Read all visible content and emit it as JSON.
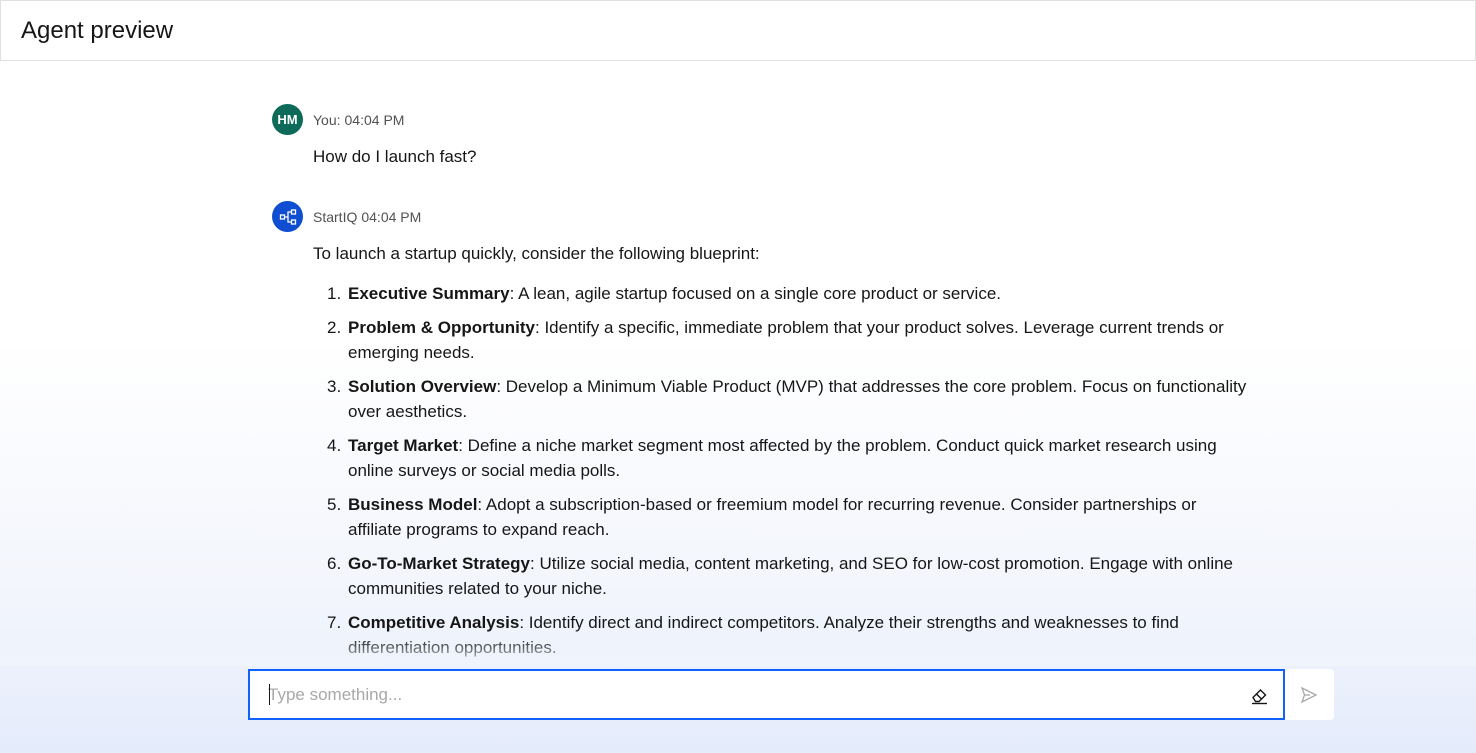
{
  "header": {
    "title": "Agent preview"
  },
  "messages": {
    "user": {
      "initials": "HM",
      "author": "You:",
      "time": "04:04 PM",
      "text": "How do I launch fast?"
    },
    "agent": {
      "author": "StartIQ",
      "time": "04:04 PM",
      "intro": "To launch a startup quickly, consider the following blueprint:",
      "items": [
        {
          "num": "1.",
          "title": "Executive Summary",
          "text": ": A lean, agile startup focused on a single core product or service."
        },
        {
          "num": "2.",
          "title": "Problem & Opportunity",
          "text": ": Identify a specific, immediate problem that your product solves. Leverage current trends or emerging needs."
        },
        {
          "num": "3.",
          "title": "Solution Overview",
          "text": ": Develop a Minimum Viable Product (MVP) that addresses the core problem. Focus on functionality over aesthetics."
        },
        {
          "num": "4.",
          "title": "Target Market",
          "text": ": Define a niche market segment most affected by the problem. Conduct quick market research using online surveys or social media polls."
        },
        {
          "num": "5.",
          "title": "Business Model",
          "text": ": Adopt a subscription-based or freemium model for recurring revenue. Consider partnerships or affiliate programs to expand reach."
        },
        {
          "num": "6.",
          "title": "Go-To-Market Strategy",
          "text": ": Utilize social media, content marketing, and SEO for low-cost promotion. Engage with online communities related to your niche."
        },
        {
          "num": "7.",
          "title": "Competitive Analysis",
          "text": ": Identify direct and indirect competitors. Analyze their strengths and weaknesses to find differentiation opportunities."
        }
      ]
    }
  },
  "composer": {
    "placeholder": "Type something...",
    "value": "",
    "clear_icon": "eraser-icon",
    "send_icon": "send-icon"
  },
  "colors": {
    "accent": "#0f62fe",
    "user_avatar": "#0e6b5a",
    "agent_avatar": "#0f4ed1"
  }
}
